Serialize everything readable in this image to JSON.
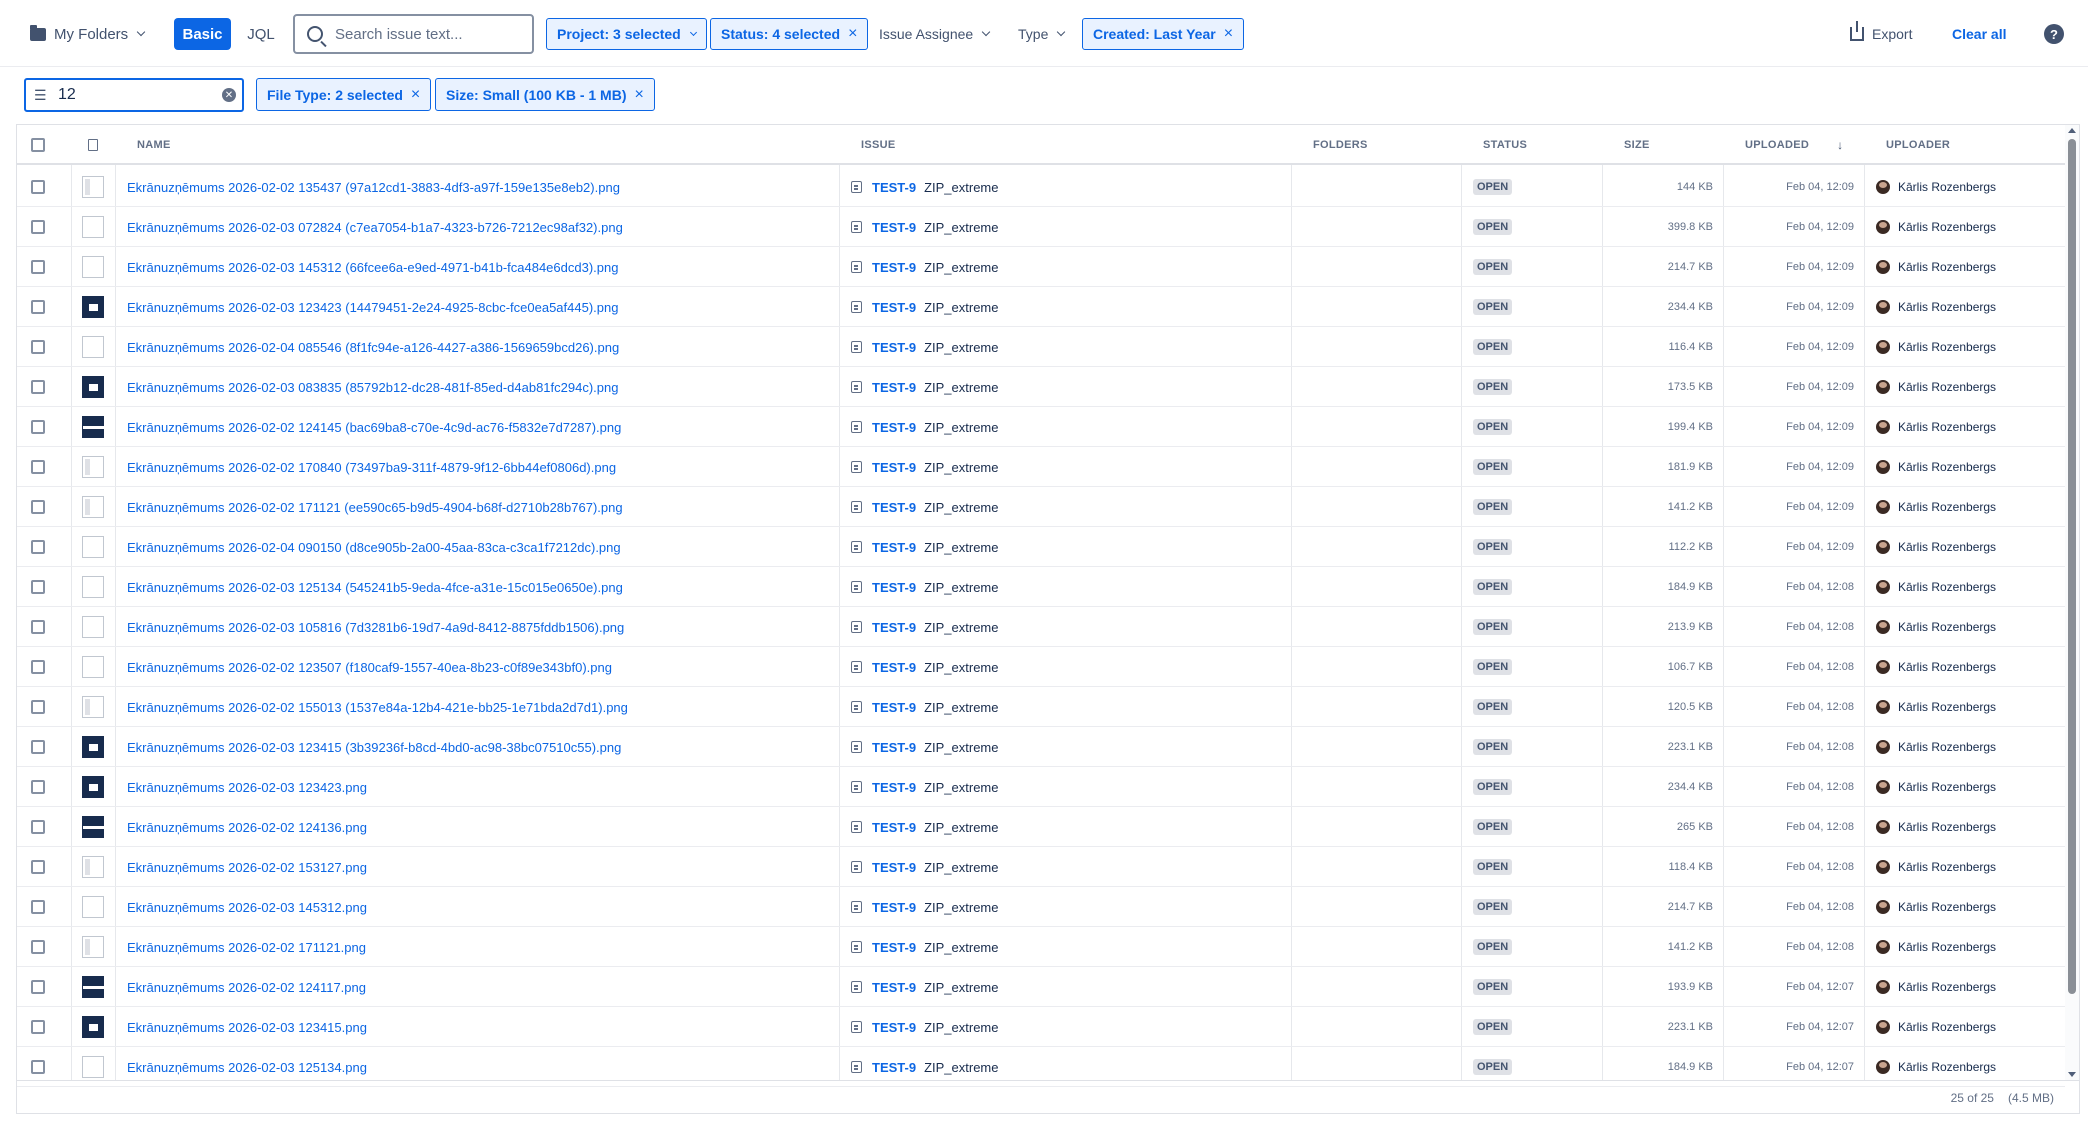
{
  "toolbar": {
    "folders_label": "My Folders",
    "basic_label": "Basic",
    "jql_label": "JQL",
    "search_placeholder": "Search issue text...",
    "project_filter": "Project: 3 selected",
    "status_filter": "Status: 4 selected",
    "assignee_filter": "Issue Assignee",
    "type_filter": "Type",
    "created_filter": "Created: Last Year",
    "export_label": "Export",
    "clear_all_label": "Clear all",
    "help_label": "?"
  },
  "filters": {
    "text_value": "12",
    "file_type": "File Type: 2 selected",
    "size": "Size: Small (100 KB - 1 MB)"
  },
  "table": {
    "columns": {
      "name": "NAME",
      "issue": "ISSUE",
      "folders": "FOLDERS",
      "status": "STATUS",
      "size": "SIZE",
      "uploaded": "UPLOADED",
      "uploader": "UPLOADER"
    },
    "rows": [
      {
        "thumb": "side",
        "name": "Ekrānuzņēmums 2026-02-02 135437 (97a12cd1-3883-4df3-a97f-159e135e8eb2).png",
        "issue_key": "TEST-9",
        "issue_summary": "ZIP_extreme",
        "status": "OPEN",
        "size": "144 KB",
        "uploaded": "Feb 04, 12:09",
        "uploader": "Kārlis Rozenbergs"
      },
      {
        "thumb": "plain",
        "name": "Ekrānuzņēmums 2026-02-03 072824 (c7ea7054-b1a7-4323-b726-7212ec98af32).png",
        "issue_key": "TEST-9",
        "issue_summary": "ZIP_extreme",
        "status": "OPEN",
        "size": "399.8 KB",
        "uploaded": "Feb 04, 12:09",
        "uploader": "Kārlis Rozenbergs"
      },
      {
        "thumb": "plain",
        "name": "Ekrānuzņēmums 2026-02-03 145312 (66fcee6a-e9ed-4971-b41b-fca484e6dcd3).png",
        "issue_key": "TEST-9",
        "issue_summary": "ZIP_extreme",
        "status": "OPEN",
        "size": "214.7 KB",
        "uploaded": "Feb 04, 12:09",
        "uploader": "Kārlis Rozenbergs"
      },
      {
        "thumb": "dark",
        "name": "Ekrānuzņēmums 2026-02-03 123423 (14479451-2e24-4925-8cbc-fce0ea5af445).png",
        "issue_key": "TEST-9",
        "issue_summary": "ZIP_extreme",
        "status": "OPEN",
        "size": "234.4 KB",
        "uploaded": "Feb 04, 12:09",
        "uploader": "Kārlis Rozenbergs"
      },
      {
        "thumb": "plain",
        "name": "Ekrānuzņēmums 2026-02-04 085546 (8f1fc94e-a126-4427-a386-1569659bcd26).png",
        "issue_key": "TEST-9",
        "issue_summary": "ZIP_extreme",
        "status": "OPEN",
        "size": "116.4 KB",
        "uploaded": "Feb 04, 12:09",
        "uploader": "Kārlis Rozenbergs"
      },
      {
        "thumb": "dark",
        "name": "Ekrānuzņēmums 2026-02-03 083835 (85792b12-dc28-481f-85ed-d4ab81fc294c).png",
        "issue_key": "TEST-9",
        "issue_summary": "ZIP_extreme",
        "status": "OPEN",
        "size": "173.5 KB",
        "uploaded": "Feb 04, 12:09",
        "uploader": "Kārlis Rozenbergs"
      },
      {
        "thumb": "bar",
        "name": "Ekrānuzņēmums 2026-02-02 124145 (bac69ba8-c70e-4c9d-ac76-f5832e7d7287).png",
        "issue_key": "TEST-9",
        "issue_summary": "ZIP_extreme",
        "status": "OPEN",
        "size": "199.4 KB",
        "uploaded": "Feb 04, 12:09",
        "uploader": "Kārlis Rozenbergs"
      },
      {
        "thumb": "side",
        "name": "Ekrānuzņēmums 2026-02-02 170840 (73497ba9-311f-4879-9f12-6bb44ef0806d).png",
        "issue_key": "TEST-9",
        "issue_summary": "ZIP_extreme",
        "status": "OPEN",
        "size": "181.9 KB",
        "uploaded": "Feb 04, 12:09",
        "uploader": "Kārlis Rozenbergs"
      },
      {
        "thumb": "side",
        "name": "Ekrānuzņēmums 2026-02-02 171121 (ee590c65-b9d5-4904-b68f-d2710b28b767).png",
        "issue_key": "TEST-9",
        "issue_summary": "ZIP_extreme",
        "status": "OPEN",
        "size": "141.2 KB",
        "uploaded": "Feb 04, 12:09",
        "uploader": "Kārlis Rozenbergs"
      },
      {
        "thumb": "plain",
        "name": "Ekrānuzņēmums 2026-02-04 090150 (d8ce905b-2a00-45aa-83ca-c3ca1f7212dc).png",
        "issue_key": "TEST-9",
        "issue_summary": "ZIP_extreme",
        "status": "OPEN",
        "size": "112.2 KB",
        "uploaded": "Feb 04, 12:09",
        "uploader": "Kārlis Rozenbergs"
      },
      {
        "thumb": "plain",
        "name": "Ekrānuzņēmums 2026-02-03 125134 (545241b5-9eda-4fce-a31e-15c015e0650e).png",
        "issue_key": "TEST-9",
        "issue_summary": "ZIP_extreme",
        "status": "OPEN",
        "size": "184.9 KB",
        "uploaded": "Feb 04, 12:08",
        "uploader": "Kārlis Rozenbergs"
      },
      {
        "thumb": "plain",
        "name": "Ekrānuzņēmums 2026-02-03 105816 (7d3281b6-19d7-4a9d-8412-8875fddb1506).png",
        "issue_key": "TEST-9",
        "issue_summary": "ZIP_extreme",
        "status": "OPEN",
        "size": "213.9 KB",
        "uploaded": "Feb 04, 12:08",
        "uploader": "Kārlis Rozenbergs"
      },
      {
        "thumb": "plain",
        "name": "Ekrānuzņēmums 2026-02-02 123507 (f180caf9-1557-40ea-8b23-c0f89e343bf0).png",
        "issue_key": "TEST-9",
        "issue_summary": "ZIP_extreme",
        "status": "OPEN",
        "size": "106.7 KB",
        "uploaded": "Feb 04, 12:08",
        "uploader": "Kārlis Rozenbergs"
      },
      {
        "thumb": "side",
        "name": "Ekrānuzņēmums 2026-02-02 155013 (1537e84a-12b4-421e-bb25-1e71bda2d7d1).png",
        "issue_key": "TEST-9",
        "issue_summary": "ZIP_extreme",
        "status": "OPEN",
        "size": "120.5 KB",
        "uploaded": "Feb 04, 12:08",
        "uploader": "Kārlis Rozenbergs"
      },
      {
        "thumb": "dark",
        "name": "Ekrānuzņēmums 2026-02-03 123415 (3b39236f-b8cd-4bd0-ac98-38bc07510c55).png",
        "issue_key": "TEST-9",
        "issue_summary": "ZIP_extreme",
        "status": "OPEN",
        "size": "223.1 KB",
        "uploaded": "Feb 04, 12:08",
        "uploader": "Kārlis Rozenbergs"
      },
      {
        "thumb": "dark",
        "name": "Ekrānuzņēmums 2026-02-03 123423.png",
        "issue_key": "TEST-9",
        "issue_summary": "ZIP_extreme",
        "status": "OPEN",
        "size": "234.4 KB",
        "uploaded": "Feb 04, 12:08",
        "uploader": "Kārlis Rozenbergs"
      },
      {
        "thumb": "bar",
        "name": "Ekrānuzņēmums 2026-02-02 124136.png",
        "issue_key": "TEST-9",
        "issue_summary": "ZIP_extreme",
        "status": "OPEN",
        "size": "265 KB",
        "uploaded": "Feb 04, 12:08",
        "uploader": "Kārlis Rozenbergs"
      },
      {
        "thumb": "side",
        "name": "Ekrānuzņēmums 2026-02-02 153127.png",
        "issue_key": "TEST-9",
        "issue_summary": "ZIP_extreme",
        "status": "OPEN",
        "size": "118.4 KB",
        "uploaded": "Feb 04, 12:08",
        "uploader": "Kārlis Rozenbergs"
      },
      {
        "thumb": "plain",
        "name": "Ekrānuzņēmums 2026-02-03 145312.png",
        "issue_key": "TEST-9",
        "issue_summary": "ZIP_extreme",
        "status": "OPEN",
        "size": "214.7 KB",
        "uploaded": "Feb 04, 12:08",
        "uploader": "Kārlis Rozenbergs"
      },
      {
        "thumb": "side",
        "name": "Ekrānuzņēmums 2026-02-02 171121.png",
        "issue_key": "TEST-9",
        "issue_summary": "ZIP_extreme",
        "status": "OPEN",
        "size": "141.2 KB",
        "uploaded": "Feb 04, 12:08",
        "uploader": "Kārlis Rozenbergs"
      },
      {
        "thumb": "bar",
        "name": "Ekrānuzņēmums 2026-02-02 124117.png",
        "issue_key": "TEST-9",
        "issue_summary": "ZIP_extreme",
        "status": "OPEN",
        "size": "193.9 KB",
        "uploaded": "Feb 04, 12:07",
        "uploader": "Kārlis Rozenbergs"
      },
      {
        "thumb": "dark",
        "name": "Ekrānuzņēmums 2026-02-03 123415.png",
        "issue_key": "TEST-9",
        "issue_summary": "ZIP_extreme",
        "status": "OPEN",
        "size": "223.1 KB",
        "uploaded": "Feb 04, 12:07",
        "uploader": "Kārlis Rozenbergs"
      },
      {
        "thumb": "plain",
        "name": "Ekrānuzņēmums 2026-02-03 125134.png",
        "issue_key": "TEST-9",
        "issue_summary": "ZIP_extreme",
        "status": "OPEN",
        "size": "184.9 KB",
        "uploaded": "Feb 04, 12:07",
        "uploader": "Kārlis Rozenbergs"
      }
    ]
  },
  "footer": {
    "count": "25 of 25",
    "total_size": "(4.5 MB)"
  }
}
